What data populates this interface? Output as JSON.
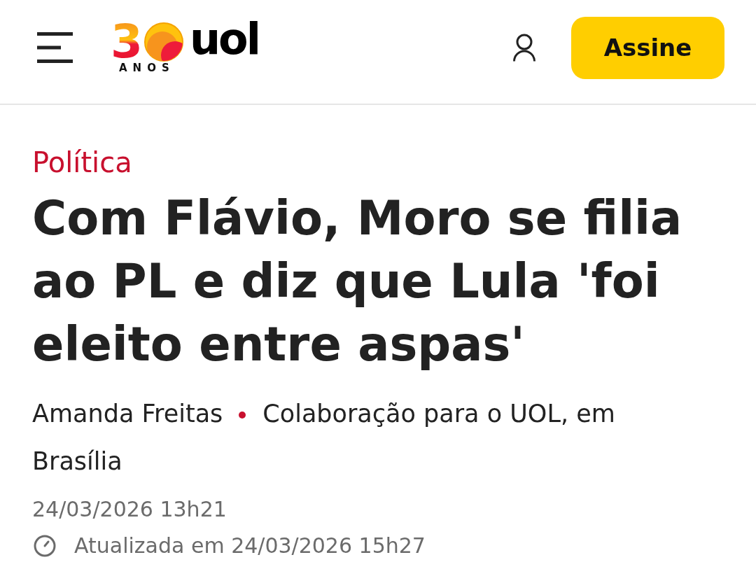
{
  "header": {
    "logo": {
      "digit": "3",
      "caption": "ANOS",
      "brand": "uol"
    },
    "subscribe_button": "Assine"
  },
  "article": {
    "section": "Política",
    "headline": "Com Flávio, Moro se filia ao PL e diz que Lula 'foi eleito entre aspas'",
    "byline": {
      "author": "Amanda Freitas",
      "source": "Colaboração para o UOL, em Brasília"
    },
    "published": "24/03/2026 13h21",
    "updated": "Atualizada em 24/03/2026 15h27"
  }
}
